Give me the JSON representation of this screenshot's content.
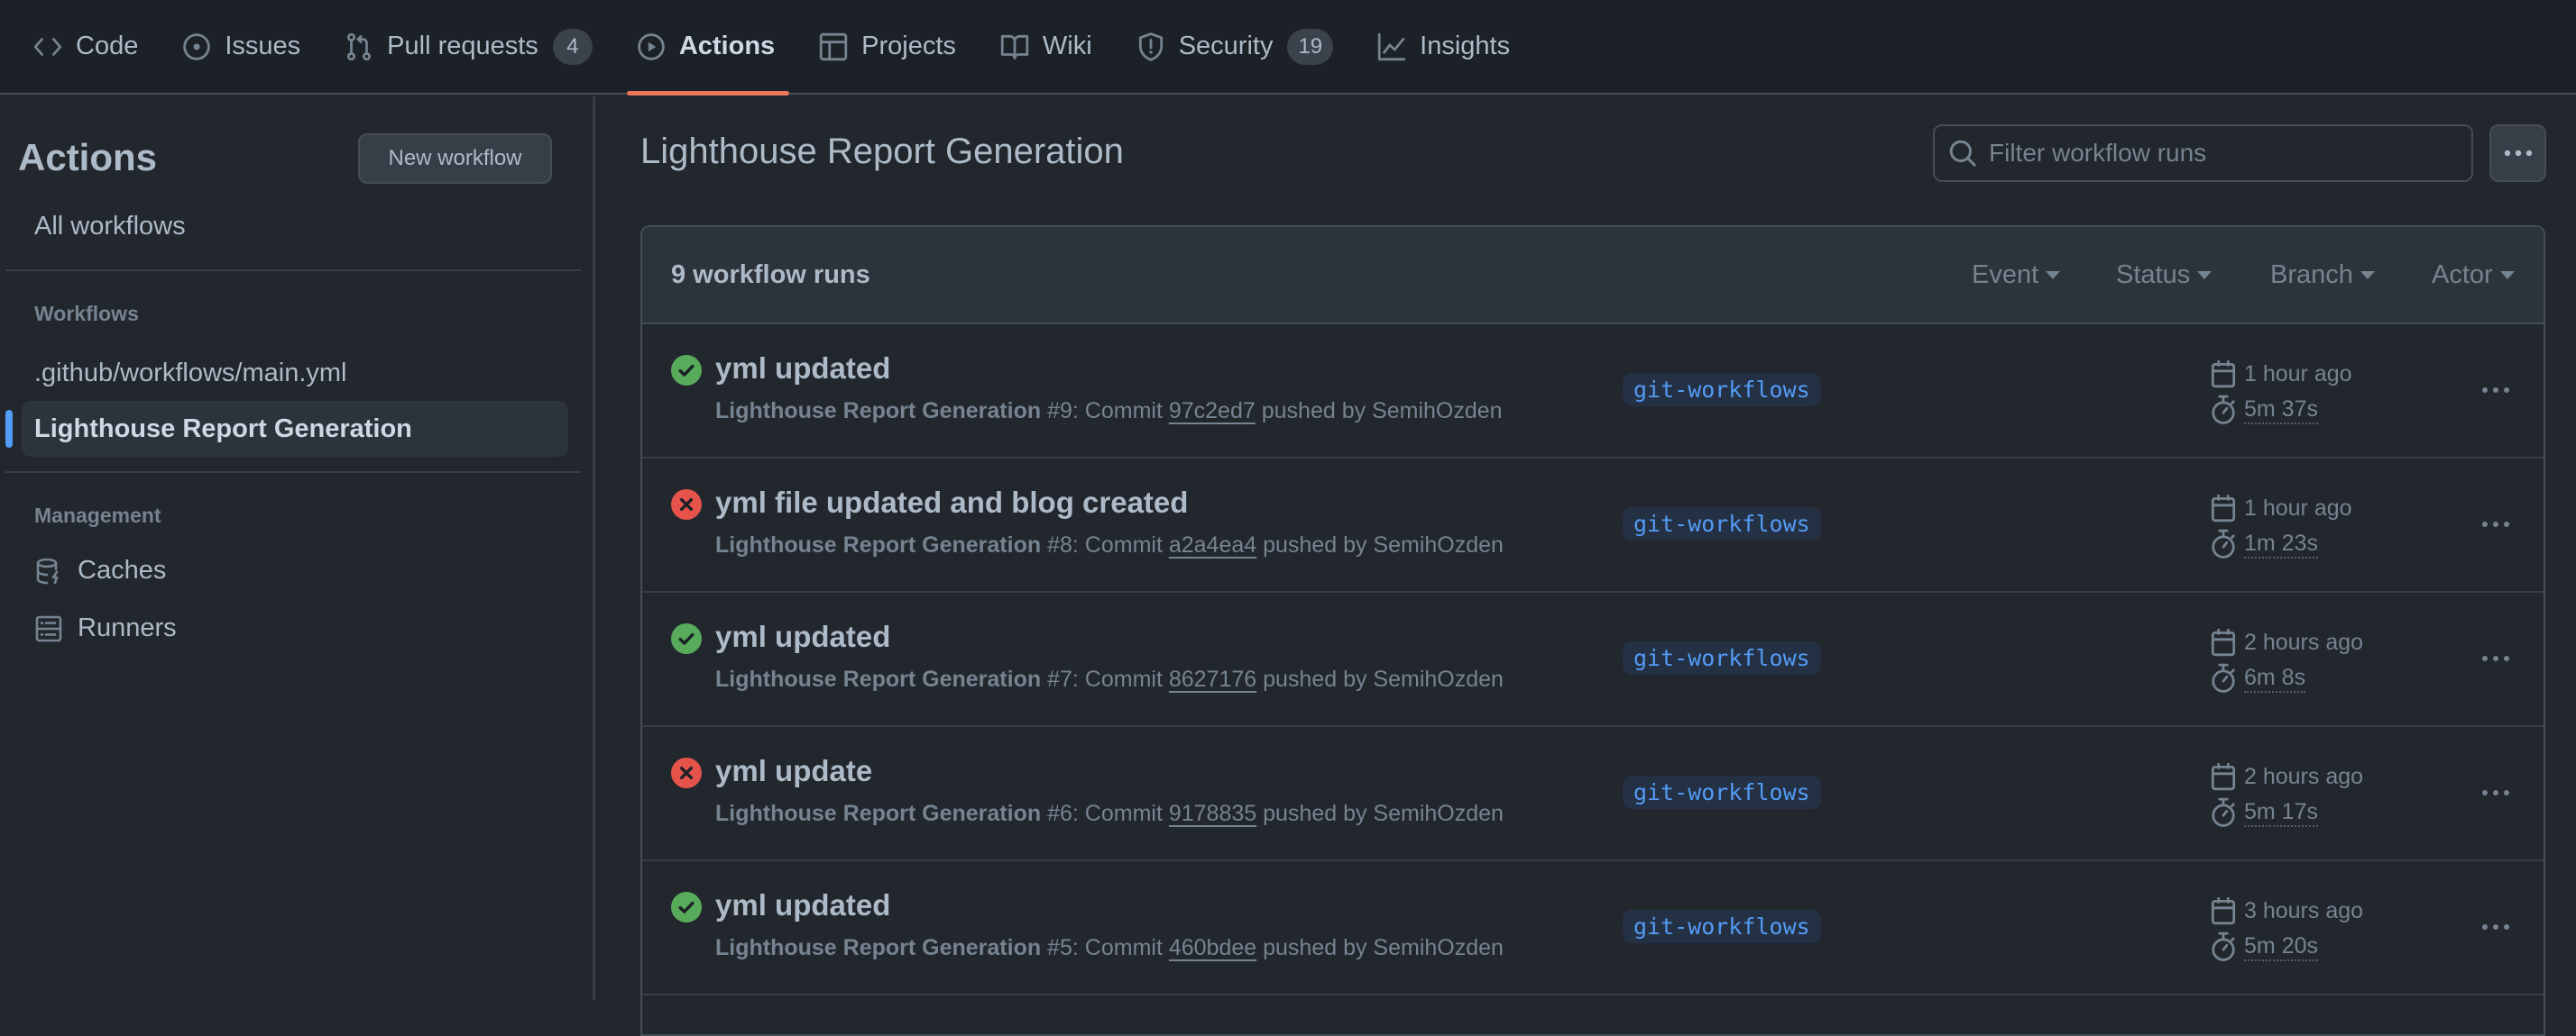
{
  "repo_nav": {
    "tabs": [
      {
        "label": "Code",
        "icon": "code-icon"
      },
      {
        "label": "Issues",
        "icon": "issue-opened-icon"
      },
      {
        "label": "Pull requests",
        "icon": "git-pull-request-icon",
        "counter": "4"
      },
      {
        "label": "Actions",
        "icon": "play-icon",
        "active": true
      },
      {
        "label": "Projects",
        "icon": "table-icon"
      },
      {
        "label": "Wiki",
        "icon": "book-icon"
      },
      {
        "label": "Security",
        "icon": "shield-icon",
        "counter": "19"
      },
      {
        "label": "Insights",
        "icon": "graph-icon"
      }
    ],
    "active_underline_color": "#ec775c"
  },
  "sidebar": {
    "title": "Actions",
    "new_workflow_label": "New workflow",
    "all_workflows_label": "All workflows",
    "workflows_heading": "Workflows",
    "workflows": [
      {
        "label": ".github/workflows/main.yml",
        "selected": false
      },
      {
        "label": "Lighthouse Report Generation",
        "selected": true
      }
    ],
    "management_heading": "Management",
    "management": [
      {
        "label": "Caches",
        "icon": "database-icon"
      },
      {
        "label": "Runners",
        "icon": "server-icon"
      }
    ],
    "selected_indicator_color": "#539bf5"
  },
  "main": {
    "title": "Lighthouse Report Generation",
    "filter_placeholder": "Filter workflow runs",
    "filter_value": "",
    "runs_count_label": "9 workflow runs",
    "filters": [
      "Event",
      "Status",
      "Branch",
      "Actor"
    ],
    "status_colors": {
      "success": "#57ab5a",
      "failure": "#e5534b"
    },
    "runs": [
      {
        "status": "success",
        "title": "yml updated",
        "workflow": "Lighthouse Report Generation",
        "number": "#9",
        "commit_prefix": ": Commit ",
        "sha": "97c2ed7",
        "pushed_by": " pushed by SemihOzden",
        "branch": "git-workflows",
        "when": "1 hour ago",
        "duration": "5m 37s"
      },
      {
        "status": "failure",
        "title": "yml file updated and blog created",
        "workflow": "Lighthouse Report Generation",
        "number": "#8",
        "commit_prefix": ": Commit ",
        "sha": "a2a4ea4",
        "pushed_by": " pushed by SemihOzden",
        "branch": "git-workflows",
        "when": "1 hour ago",
        "duration": "1m 23s"
      },
      {
        "status": "success",
        "title": "yml updated",
        "workflow": "Lighthouse Report Generation",
        "number": "#7",
        "commit_prefix": ": Commit ",
        "sha": "8627176",
        "pushed_by": " pushed by SemihOzden",
        "branch": "git-workflows",
        "when": "2 hours ago",
        "duration": "6m 8s"
      },
      {
        "status": "failure",
        "title": "yml update",
        "workflow": "Lighthouse Report Generation",
        "number": "#6",
        "commit_prefix": ": Commit ",
        "sha": "9178835",
        "pushed_by": " pushed by SemihOzden",
        "branch": "git-workflows",
        "when": "2 hours ago",
        "duration": "5m 17s"
      },
      {
        "status": "success",
        "title": "yml updated",
        "workflow": "Lighthouse Report Generation",
        "number": "#5",
        "commit_prefix": ": Commit ",
        "sha": "460bdee",
        "pushed_by": " pushed by SemihOzden",
        "branch": "git-workflows",
        "when": "3 hours ago",
        "duration": "5m 20s"
      }
    ]
  }
}
